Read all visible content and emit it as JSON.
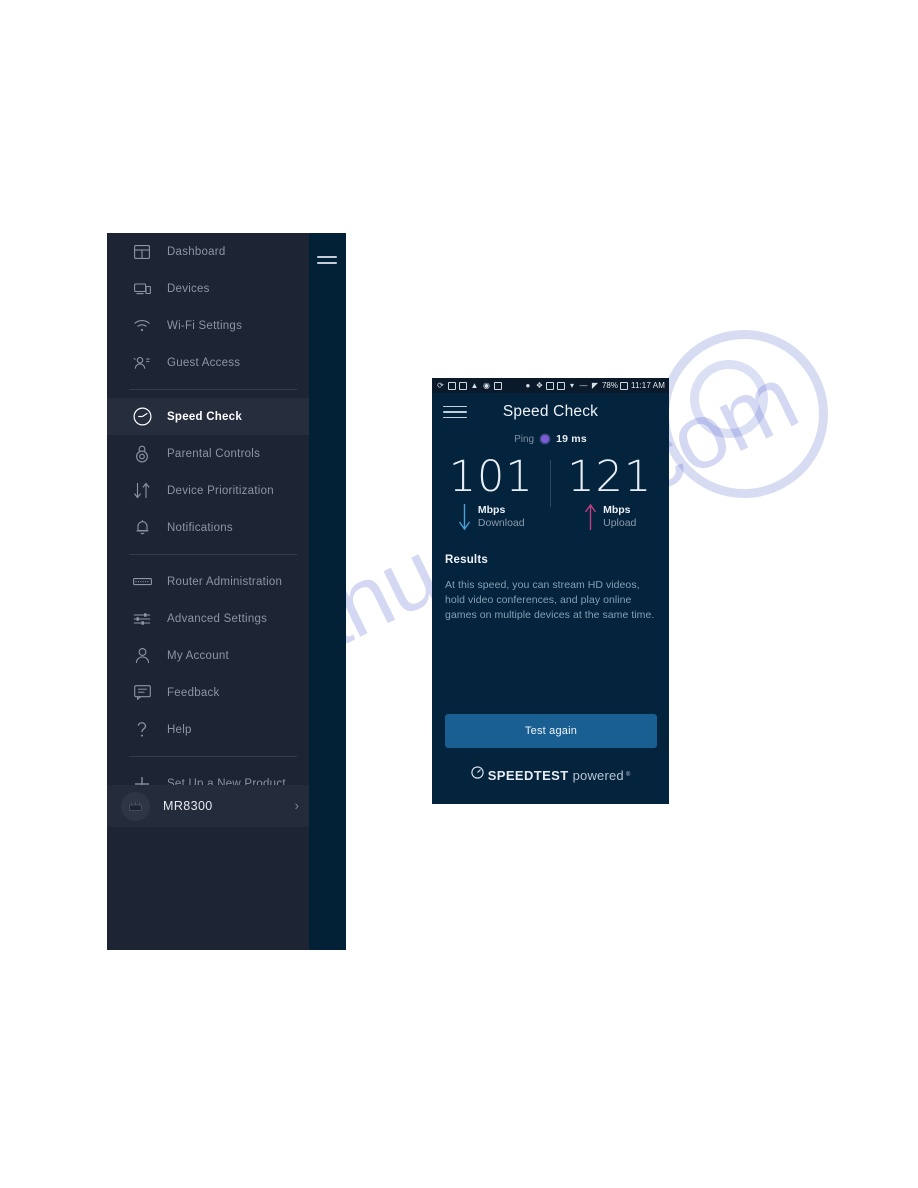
{
  "sidebar": {
    "hamburger_icon": "hamburger-menu-icon",
    "items": [
      {
        "label": "Dashboard",
        "icon": "dashboard-icon",
        "active": false,
        "separator_after": false
      },
      {
        "label": "Devices",
        "icon": "devices-icon",
        "active": false,
        "separator_after": false
      },
      {
        "label": "Wi-Fi Settings",
        "icon": "wifi-icon",
        "active": false,
        "separator_after": false
      },
      {
        "label": "Guest Access",
        "icon": "guest-access-icon",
        "active": false,
        "separator_after": true
      },
      {
        "label": "Speed Check",
        "icon": "speedometer-icon",
        "active": true,
        "separator_after": false
      },
      {
        "label": "Parental Controls",
        "icon": "parental-controls-icon",
        "active": false,
        "separator_after": false
      },
      {
        "label": "Device Prioritization",
        "icon": "up-down-arrows-icon",
        "active": false,
        "separator_after": false
      },
      {
        "label": "Notifications",
        "icon": "bell-icon",
        "active": false,
        "separator_after": true
      },
      {
        "label": "Router Administration",
        "icon": "router-icon",
        "active": false,
        "separator_after": false
      },
      {
        "label": "Advanced Settings",
        "icon": "sliders-icon",
        "active": false,
        "separator_after": false
      },
      {
        "label": "My Account",
        "icon": "person-icon",
        "active": false,
        "separator_after": false
      },
      {
        "label": "Feedback",
        "icon": "chat-bubble-icon",
        "active": false,
        "separator_after": false
      },
      {
        "label": "Help",
        "icon": "question-mark-icon",
        "active": false,
        "separator_after": true
      },
      {
        "label": "Set Up a New Product",
        "icon": "plus-icon",
        "active": false,
        "separator_after": false
      }
    ],
    "router": {
      "name": "MR8300",
      "avatar_icon": "router-device-icon",
      "chevron_icon": "chevron-right-icon"
    }
  },
  "phone": {
    "status_bar": {
      "left_icons": [
        "sync-icon",
        "photo-icon",
        "vpn-key-icon",
        "figure-icon",
        "message-icon",
        "email-icon"
      ],
      "right_icons": [
        "location-icon",
        "bluetooth-icon",
        "nfc-icon",
        "alarm-icon",
        "wifi-icon",
        "hd-icon",
        "signal-bars-icon"
      ],
      "battery_percent": "78%",
      "battery_icon": "battery-icon",
      "clock": "11:17 AM"
    },
    "appbar": {
      "menu_icon": "hamburger-menu-icon",
      "title": "Speed Check"
    },
    "ping": {
      "label": "Ping",
      "dot_color": "#7b5bd6",
      "value": "19 ms"
    },
    "download": {
      "value": "101",
      "unit": "Mbps",
      "direction": "Download",
      "arrow_icon": "arrow-down-icon",
      "arrow_color": "#4f9fd4"
    },
    "upload": {
      "value": "121",
      "unit": "Mbps",
      "direction": "Upload",
      "arrow_icon": "arrow-up-icon",
      "arrow_color": "#c0417f"
    },
    "results": {
      "title": "Results",
      "body": "At this speed, you can stream HD videos, hold video conferences, and play online games on multiple devices at the same time."
    },
    "test_again_label": "Test again",
    "brand": {
      "icon": "speedtest-gauge-icon",
      "name": "SPEEDTEST",
      "powered": "powered",
      "trademark": "®"
    }
  },
  "watermark": {
    "text": "manualslib.com"
  },
  "colors": {
    "sidebar_bg": "#1d2433",
    "sidebar_rail": "#022136",
    "sidebar_active": "#262d3d",
    "phone_bg": "#04233c",
    "button": "#1a5f92",
    "ping_dot": "#7b5bd6",
    "download_arrow": "#4f9fd4",
    "upload_arrow": "#c0417f"
  }
}
